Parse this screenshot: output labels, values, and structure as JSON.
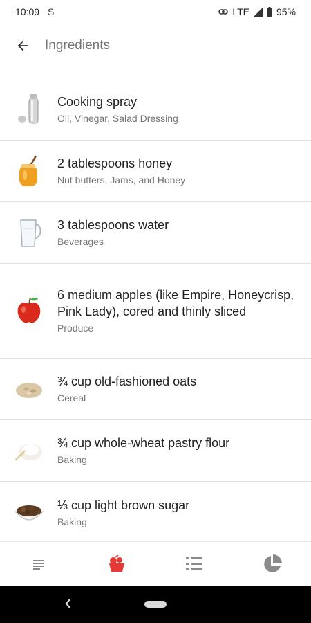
{
  "status_bar": {
    "time": "10:09",
    "network": "LTE",
    "battery": "95%"
  },
  "header": {
    "title": "Ingredients"
  },
  "ingredients": [
    {
      "name": "Cooking spray",
      "category": "Oil, Vinegar, Salad Dressing",
      "icon": "cooking-spray-icon"
    },
    {
      "name": "2 tablespoons honey",
      "category": "Nut butters, Jams, and Honey",
      "icon": "honey-jar-icon"
    },
    {
      "name": "3 tablespoons water",
      "category": "Beverages",
      "icon": "water-pitcher-icon"
    },
    {
      "name": "6 medium apples (like Empire, Honeycrisp, Pink Lady), cored and thinly sliced",
      "category": "Produce",
      "icon": "apple-icon"
    },
    {
      "name": "¾ cup old-fashioned oats",
      "category": "Cereal",
      "icon": "oats-icon"
    },
    {
      "name": "¾ cup whole-wheat pastry flour",
      "category": "Baking",
      "icon": "flour-icon"
    },
    {
      "name": "⅓ cup light brown sugar",
      "category": "Baking",
      "icon": "brown-sugar-icon"
    }
  ],
  "bottom_nav": {
    "items": [
      "description-tab",
      "ingredients-tab",
      "directions-tab",
      "nutrition-tab"
    ],
    "active": "ingredients-tab"
  },
  "colors": {
    "accent": "#e53935",
    "inactive_icon": "#8a8a8a",
    "divider": "#e0e0e0"
  }
}
